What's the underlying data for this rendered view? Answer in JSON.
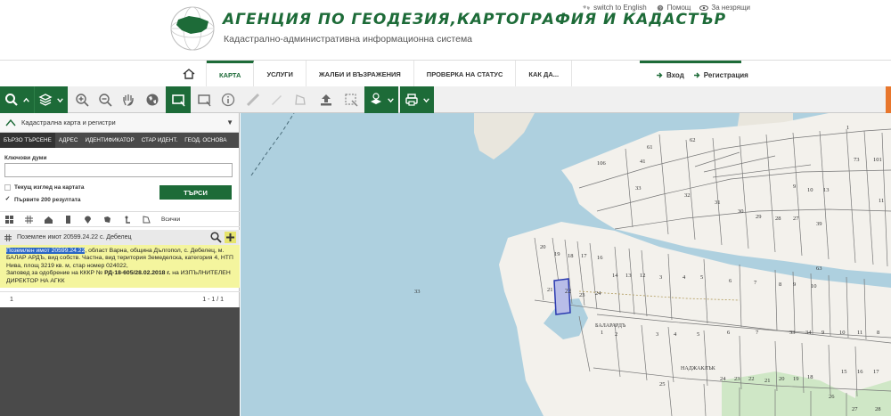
{
  "header": {
    "title": "АГЕНЦИЯ ПО ГЕОДЕЗИЯ,КАРТОГРАФИЯ И КАДАСТЪР",
    "subtitle": "Кадастрално-административна информационна система",
    "top_links": [
      "switch to English",
      "Помощ",
      "За незрящи"
    ]
  },
  "nav": {
    "items": [
      "КАРТА",
      "УСЛУГИ",
      "ЖАЛБИ И ВЪЗРАЖЕНИЯ",
      "ПРОВЕРКА НА СТАТУС",
      "КАК ДА..."
    ],
    "login": "Вход",
    "register": "Регистрация"
  },
  "toolbar": {
    "icons": [
      "search-icon",
      "layers-icon",
      "zoom-in-icon",
      "zoom-out-icon",
      "hand-icon",
      "globe-icon",
      "select-icon",
      "select-outline-icon",
      "info-icon",
      "ruler-icon",
      "area-icon",
      "upload-icon",
      "clear-icon",
      "identify-icon",
      "print-icon"
    ]
  },
  "panel": {
    "title": "Кадастрална карта и регистри",
    "tabs": [
      "БЪРЗО ТЪРСЕНЕ",
      "АДРЕС",
      "ИДЕНТИФИКАТОР",
      "СТАР ИДЕНТ.",
      "ГЕОД. ОСНОВА"
    ],
    "keywords_label": "Ключови думи",
    "current_view_label": "Текущ изглед на картата",
    "first_200_label": "Първите 200 резултата",
    "search_button": "ТЪРСИ",
    "filter_all": "Всички",
    "result_title": "Поземлен имот 20599.24.22 с. Дебелец",
    "result_highlight": "Поземлен имот 20599.24.22",
    "result_text": ", област Варна, община Дългопол, с. Дебелец, м. БАЛАР АРДЪ, вид собств. Частна, вид територия Земеделска, категория 4, НТП Нива, площ 3219 кв. м, стар номер 024022,",
    "result_order_prefix": "Заповед за одобрение на КККР №",
    "result_order_number": "РД-18-605/28.02.2018 г.",
    "result_order_suffix": "на ИЗПЪЛНИТЕЛЕН ДИРЕКТОР НА АГКК",
    "page": "1",
    "page_range": "1 - 1 / 1"
  },
  "map": {
    "labels": {
      "water": "33",
      "parcel_selected": "22",
      "road_1": "БАЛАРАРДЪ",
      "road_2": "НАДЖАКЛЪК",
      "parcels_upper": [
        "1",
        "62",
        "61",
        "106",
        "41",
        "73",
        "101",
        "33",
        "32",
        "31",
        "30",
        "29",
        "28",
        "27",
        "39",
        "9",
        "10",
        "13",
        "11"
      ],
      "parcels_mid": [
        "20",
        "19",
        "18",
        "17",
        "16",
        "14",
        "13",
        "12",
        "3",
        "4",
        "5",
        "6",
        "7",
        "8",
        "9",
        "10",
        "63",
        "21",
        "23",
        "24"
      ],
      "parcels_lower": [
        "1",
        "2",
        "3",
        "4",
        "5",
        "6",
        "7",
        "33",
        "34",
        "9",
        "10",
        "11",
        "8",
        "17",
        "16",
        "15",
        "25",
        "24",
        "23",
        "22",
        "21",
        "20",
        "19",
        "18",
        "26",
        "27",
        "28"
      ]
    }
  }
}
